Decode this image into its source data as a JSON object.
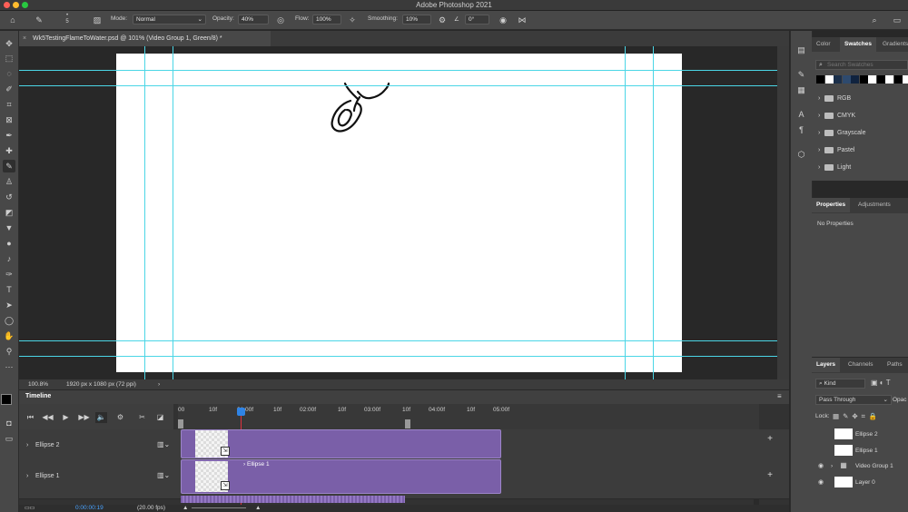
{
  "app": {
    "title": "Adobe Photoshop 2021"
  },
  "options": {
    "brush_size": "5",
    "mode_label": "Mode:",
    "mode_value": "Normal",
    "opacity_label": "Opacity:",
    "opacity_value": "40%",
    "flow_label": "Flow:",
    "flow_value": "100%",
    "smoothing_label": "Smoothing:",
    "smoothing_value": "10%",
    "angle_value": "0°"
  },
  "document": {
    "tab_title": "Wk5TestingFlameToWater.psd @ 101% (Video Group 1, Green/8) *",
    "zoom": "100.8%",
    "dimensions": "1920 px x 1080 px (72 ppi)"
  },
  "swatches": {
    "tabs": [
      "Color",
      "Swatches",
      "Gradients"
    ],
    "search_placeholder": "Search Swatches",
    "colors": [
      "#000000",
      "#ffffff",
      "#1b2f4a",
      "#2e4a6e",
      "#10233f",
      "#000000",
      "#ffffff",
      "#000000",
      "#ffffff",
      "#000000",
      "#ffffff"
    ],
    "folders": [
      "RGB",
      "CMYK",
      "Grayscale",
      "Pastel",
      "Light"
    ]
  },
  "properties": {
    "tabs": [
      "Properties",
      "Adjustments"
    ],
    "empty_text": "No Properties"
  },
  "layers": {
    "tabs": [
      "Layers",
      "Channels",
      "Paths"
    ],
    "filter_value": "Kind",
    "blend_value": "Pass Through",
    "opacity_label": "Opac",
    "lock_label": "Lock:",
    "items": [
      "Ellipse 2",
      "Ellipse 1",
      "Video Group 1",
      "Layer 0"
    ]
  },
  "timeline": {
    "title": "Timeline",
    "ruler": [
      "00",
      "10f",
      "01:00f",
      "10f",
      "02:00f",
      "10f",
      "03:00f",
      "10f",
      "04:00f",
      "10f",
      "05:00f"
    ],
    "tracks": [
      "Ellipse 2",
      "Ellipse 1"
    ],
    "clip_label": "Ellipse 1",
    "timecode": "0:00:00:19",
    "fps": "(20.00 fps)"
  }
}
